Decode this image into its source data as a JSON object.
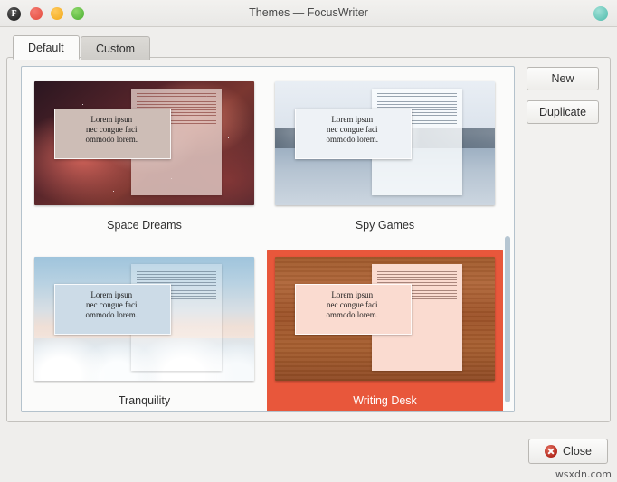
{
  "window": {
    "title": "Themes — FocusWriter",
    "app_icon": "F",
    "controls": {
      "close": "window-close",
      "minimize": "window-minimize",
      "maximize": "window-maximize",
      "status": "status-indicator"
    }
  },
  "tabs": [
    {
      "label": "Default",
      "active": true
    },
    {
      "label": "Custom",
      "active": false
    }
  ],
  "themes": [
    {
      "name": "Space Dreams",
      "selected": false,
      "preview_text": [
        "Lorem ipsun",
        "nec congue faci",
        "ommodo lorem."
      ]
    },
    {
      "name": "Spy Games",
      "selected": false,
      "preview_text": [
        "Lorem ipsun",
        "nec congue faci",
        "ommodo lorem."
      ]
    },
    {
      "name": "Tranquility",
      "selected": false,
      "preview_text": [
        "Lorem ipsun",
        "nec congue faci",
        "ommodo lorem."
      ]
    },
    {
      "name": "Writing Desk",
      "selected": true,
      "preview_text": [
        "Lorem ipsun",
        "nec congue faci",
        "ommodo lorem."
      ]
    }
  ],
  "side_buttons": {
    "new": "New",
    "duplicate": "Duplicate"
  },
  "footer": {
    "close": "Close",
    "close_icon": "error-close-icon"
  },
  "watermark": "wsxdn.com",
  "colors": {
    "selection": "#e8573b",
    "window_bg": "#efeeec",
    "list_bg": "#fbfbfa",
    "scrollbar_thumb": "#b6c6d2"
  }
}
